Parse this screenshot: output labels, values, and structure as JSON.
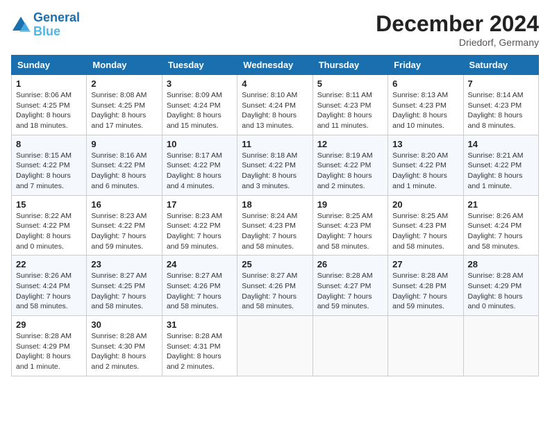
{
  "header": {
    "logo_line1": "General",
    "logo_line2": "Blue",
    "month": "December 2024",
    "location": "Driedorf, Germany"
  },
  "weekdays": [
    "Sunday",
    "Monday",
    "Tuesday",
    "Wednesday",
    "Thursday",
    "Friday",
    "Saturday"
  ],
  "weeks": [
    [
      {
        "day": "1",
        "sunrise": "8:06 AM",
        "sunset": "4:25 PM",
        "daylight": "8 hours and 18 minutes."
      },
      {
        "day": "2",
        "sunrise": "8:08 AM",
        "sunset": "4:25 PM",
        "daylight": "8 hours and 17 minutes."
      },
      {
        "day": "3",
        "sunrise": "8:09 AM",
        "sunset": "4:24 PM",
        "daylight": "8 hours and 15 minutes."
      },
      {
        "day": "4",
        "sunrise": "8:10 AM",
        "sunset": "4:24 PM",
        "daylight": "8 hours and 13 minutes."
      },
      {
        "day": "5",
        "sunrise": "8:11 AM",
        "sunset": "4:23 PM",
        "daylight": "8 hours and 11 minutes."
      },
      {
        "day": "6",
        "sunrise": "8:13 AM",
        "sunset": "4:23 PM",
        "daylight": "8 hours and 10 minutes."
      },
      {
        "day": "7",
        "sunrise": "8:14 AM",
        "sunset": "4:23 PM",
        "daylight": "8 hours and 8 minutes."
      }
    ],
    [
      {
        "day": "8",
        "sunrise": "8:15 AM",
        "sunset": "4:22 PM",
        "daylight": "8 hours and 7 minutes."
      },
      {
        "day": "9",
        "sunrise": "8:16 AM",
        "sunset": "4:22 PM",
        "daylight": "8 hours and 6 minutes."
      },
      {
        "day": "10",
        "sunrise": "8:17 AM",
        "sunset": "4:22 PM",
        "daylight": "8 hours and 4 minutes."
      },
      {
        "day": "11",
        "sunrise": "8:18 AM",
        "sunset": "4:22 PM",
        "daylight": "8 hours and 3 minutes."
      },
      {
        "day": "12",
        "sunrise": "8:19 AM",
        "sunset": "4:22 PM",
        "daylight": "8 hours and 2 minutes."
      },
      {
        "day": "13",
        "sunrise": "8:20 AM",
        "sunset": "4:22 PM",
        "daylight": "8 hours and 1 minute."
      },
      {
        "day": "14",
        "sunrise": "8:21 AM",
        "sunset": "4:22 PM",
        "daylight": "8 hours and 1 minute."
      }
    ],
    [
      {
        "day": "15",
        "sunrise": "8:22 AM",
        "sunset": "4:22 PM",
        "daylight": "8 hours and 0 minutes."
      },
      {
        "day": "16",
        "sunrise": "8:23 AM",
        "sunset": "4:22 PM",
        "daylight": "7 hours and 59 minutes."
      },
      {
        "day": "17",
        "sunrise": "8:23 AM",
        "sunset": "4:22 PM",
        "daylight": "7 hours and 59 minutes."
      },
      {
        "day": "18",
        "sunrise": "8:24 AM",
        "sunset": "4:23 PM",
        "daylight": "7 hours and 58 minutes."
      },
      {
        "day": "19",
        "sunrise": "8:25 AM",
        "sunset": "4:23 PM",
        "daylight": "7 hours and 58 minutes."
      },
      {
        "day": "20",
        "sunrise": "8:25 AM",
        "sunset": "4:23 PM",
        "daylight": "7 hours and 58 minutes."
      },
      {
        "day": "21",
        "sunrise": "8:26 AM",
        "sunset": "4:24 PM",
        "daylight": "7 hours and 58 minutes."
      }
    ],
    [
      {
        "day": "22",
        "sunrise": "8:26 AM",
        "sunset": "4:24 PM",
        "daylight": "7 hours and 58 minutes."
      },
      {
        "day": "23",
        "sunrise": "8:27 AM",
        "sunset": "4:25 PM",
        "daylight": "7 hours and 58 minutes."
      },
      {
        "day": "24",
        "sunrise": "8:27 AM",
        "sunset": "4:26 PM",
        "daylight": "7 hours and 58 minutes."
      },
      {
        "day": "25",
        "sunrise": "8:27 AM",
        "sunset": "4:26 PM",
        "daylight": "7 hours and 58 minutes."
      },
      {
        "day": "26",
        "sunrise": "8:28 AM",
        "sunset": "4:27 PM",
        "daylight": "7 hours and 59 minutes."
      },
      {
        "day": "27",
        "sunrise": "8:28 AM",
        "sunset": "4:28 PM",
        "daylight": "7 hours and 59 minutes."
      },
      {
        "day": "28",
        "sunrise": "8:28 AM",
        "sunset": "4:29 PM",
        "daylight": "8 hours and 0 minutes."
      }
    ],
    [
      {
        "day": "29",
        "sunrise": "8:28 AM",
        "sunset": "4:29 PM",
        "daylight": "8 hours and 1 minute."
      },
      {
        "day": "30",
        "sunrise": "8:28 AM",
        "sunset": "4:30 PM",
        "daylight": "8 hours and 2 minutes."
      },
      {
        "day": "31",
        "sunrise": "8:28 AM",
        "sunset": "4:31 PM",
        "daylight": "8 hours and 2 minutes."
      },
      null,
      null,
      null,
      null
    ]
  ]
}
